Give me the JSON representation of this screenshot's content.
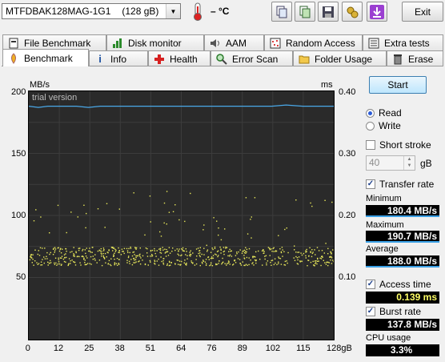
{
  "toolbar": {
    "drive_name": "MTFDBAK128MAG-1G1",
    "drive_capacity": "(128 gB)",
    "temperature": "– °C",
    "exit_label": "Exit"
  },
  "tabs_row1": [
    {
      "label": "File Benchmark",
      "icon": "file-benchmark-icon"
    },
    {
      "label": "Disk monitor",
      "icon": "disk-monitor-icon"
    },
    {
      "label": "AAM",
      "icon": "speaker-icon"
    },
    {
      "label": "Random Access",
      "icon": "random-access-icon"
    },
    {
      "label": "Extra tests",
      "icon": "extra-tests-icon"
    }
  ],
  "tabs_row2": [
    {
      "label": "Benchmark",
      "icon": "benchmark-icon",
      "active": true
    },
    {
      "label": "Info",
      "icon": "info-icon"
    },
    {
      "label": "Health",
      "icon": "health-cross-icon"
    },
    {
      "label": "Error Scan",
      "icon": "magnifier-icon"
    },
    {
      "label": "Folder Usage",
      "icon": "folder-icon"
    },
    {
      "label": "Erase",
      "icon": "trash-icon"
    }
  ],
  "chart": {
    "left_unit": "MB/s",
    "right_unit": "ms",
    "watermark": "trial version",
    "y_ticks_left": [
      "200",
      "150",
      "100",
      "50"
    ],
    "y_ticks_right": [
      "0.40",
      "0.30",
      "0.20",
      "0.10"
    ],
    "x_ticks": [
      "0",
      "12",
      "25",
      "38",
      "51",
      "64",
      "76",
      "89",
      "102",
      "115",
      "128gB"
    ]
  },
  "chart_data": {
    "type": "line",
    "xlabel": "",
    "ylabel": "MB/s",
    "xlim": [
      0,
      128
    ],
    "ylim": [
      0,
      200
    ],
    "y2lim": [
      0,
      0.4
    ],
    "grid": true,
    "series": [
      {
        "name": "",
        "axis": "left",
        "color": "#4aa8e8",
        "x": [
          0,
          4,
          8,
          12,
          16,
          20,
          25,
          30,
          38,
          44,
          51,
          58,
          64,
          70,
          76,
          83,
          89,
          96,
          102,
          108,
          115,
          121,
          128
        ],
        "y": [
          188,
          187,
          188,
          188,
          188,
          188,
          187,
          188,
          188,
          188,
          188,
          188,
          188,
          188,
          188,
          188,
          188,
          188,
          188,
          189,
          188,
          188,
          188
        ]
      },
      {
        "name": "",
        "axis": "right",
        "type": "scatter",
        "color": "#e8e85a",
        "x_range": [
          0,
          128
        ],
        "y_typical": [
          0.12,
          0.15
        ],
        "y_max": 0.24
      }
    ]
  },
  "side": {
    "start_label": "Start",
    "read_label": "Read",
    "write_label": "Write",
    "short_stroke_label": "Short stroke",
    "short_stroke_value": "40",
    "gb_label": "gB",
    "transfer_rate_label": "Transfer rate",
    "minimum_label": "Minimum",
    "minimum_value": "180.4 MB/s",
    "maximum_label": "Maximum",
    "maximum_value": "190.7 MB/s",
    "average_label": "Average",
    "average_value": "188.0 MB/s",
    "access_time_label": "Access time",
    "access_time_value": "0.139 ms",
    "burst_rate_label": "Burst rate",
    "burst_rate_value": "137.8 MB/s",
    "cpu_usage_label": "CPU usage",
    "cpu_usage_value": "3.3%"
  }
}
